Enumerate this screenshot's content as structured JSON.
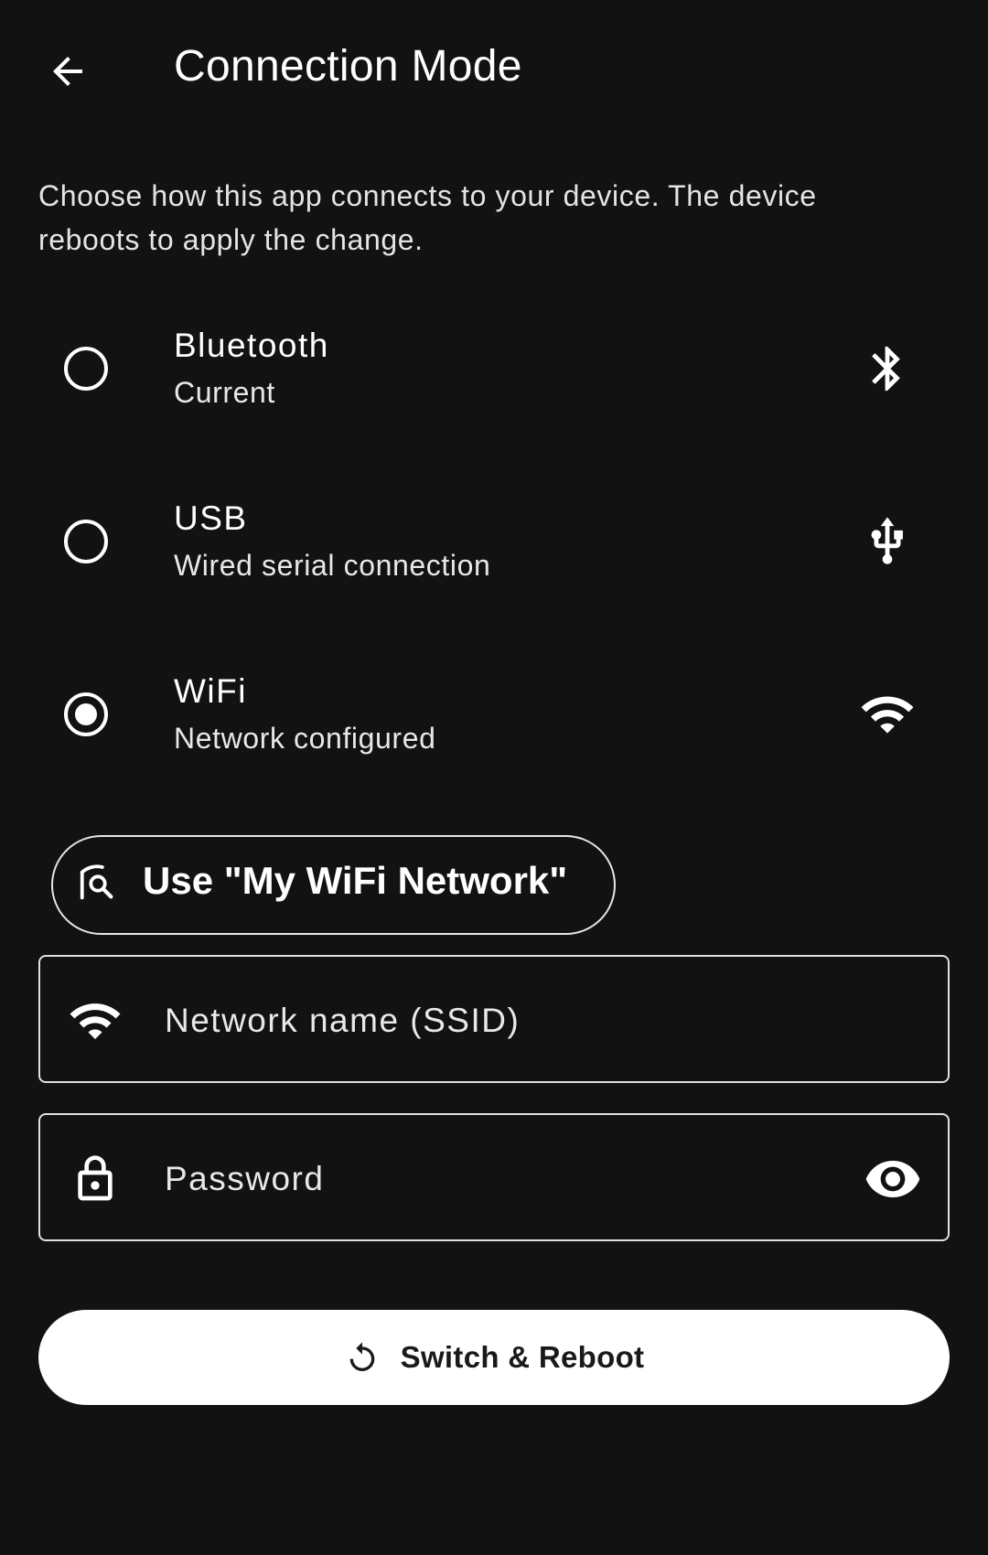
{
  "app_bar": {
    "title": "Connection Mode",
    "back_icon": "arrow-back-icon"
  },
  "description": "Choose how this app connects to your device. The device reboots to apply the change.",
  "options": [
    {
      "title": "Bluetooth",
      "subtitle": "Current",
      "icon": "bluetooth-icon",
      "selected": false
    },
    {
      "title": "USB",
      "subtitle": "Wired serial connection",
      "icon": "usb-icon",
      "selected": false
    },
    {
      "title": "WiFi",
      "subtitle": "Network configured",
      "icon": "wifi-icon",
      "selected": true
    }
  ],
  "suggestion_chip": {
    "label": "Use \"My WiFi Network\"",
    "icon": "wifi-find-icon"
  },
  "ssid_field": {
    "placeholder": "Network name (SSID)",
    "value": "",
    "icon": "wifi-icon"
  },
  "password_field": {
    "placeholder": "Password",
    "value": "",
    "icon": "lock-icon",
    "toggle_icon": "eye-icon"
  },
  "primary_button": {
    "label": "Switch & Reboot",
    "icon": "restart-icon"
  },
  "colors": {
    "background": "#121212",
    "foreground": "#ffffff",
    "button_background": "#ffffff",
    "button_text": "#1a1a1a"
  }
}
